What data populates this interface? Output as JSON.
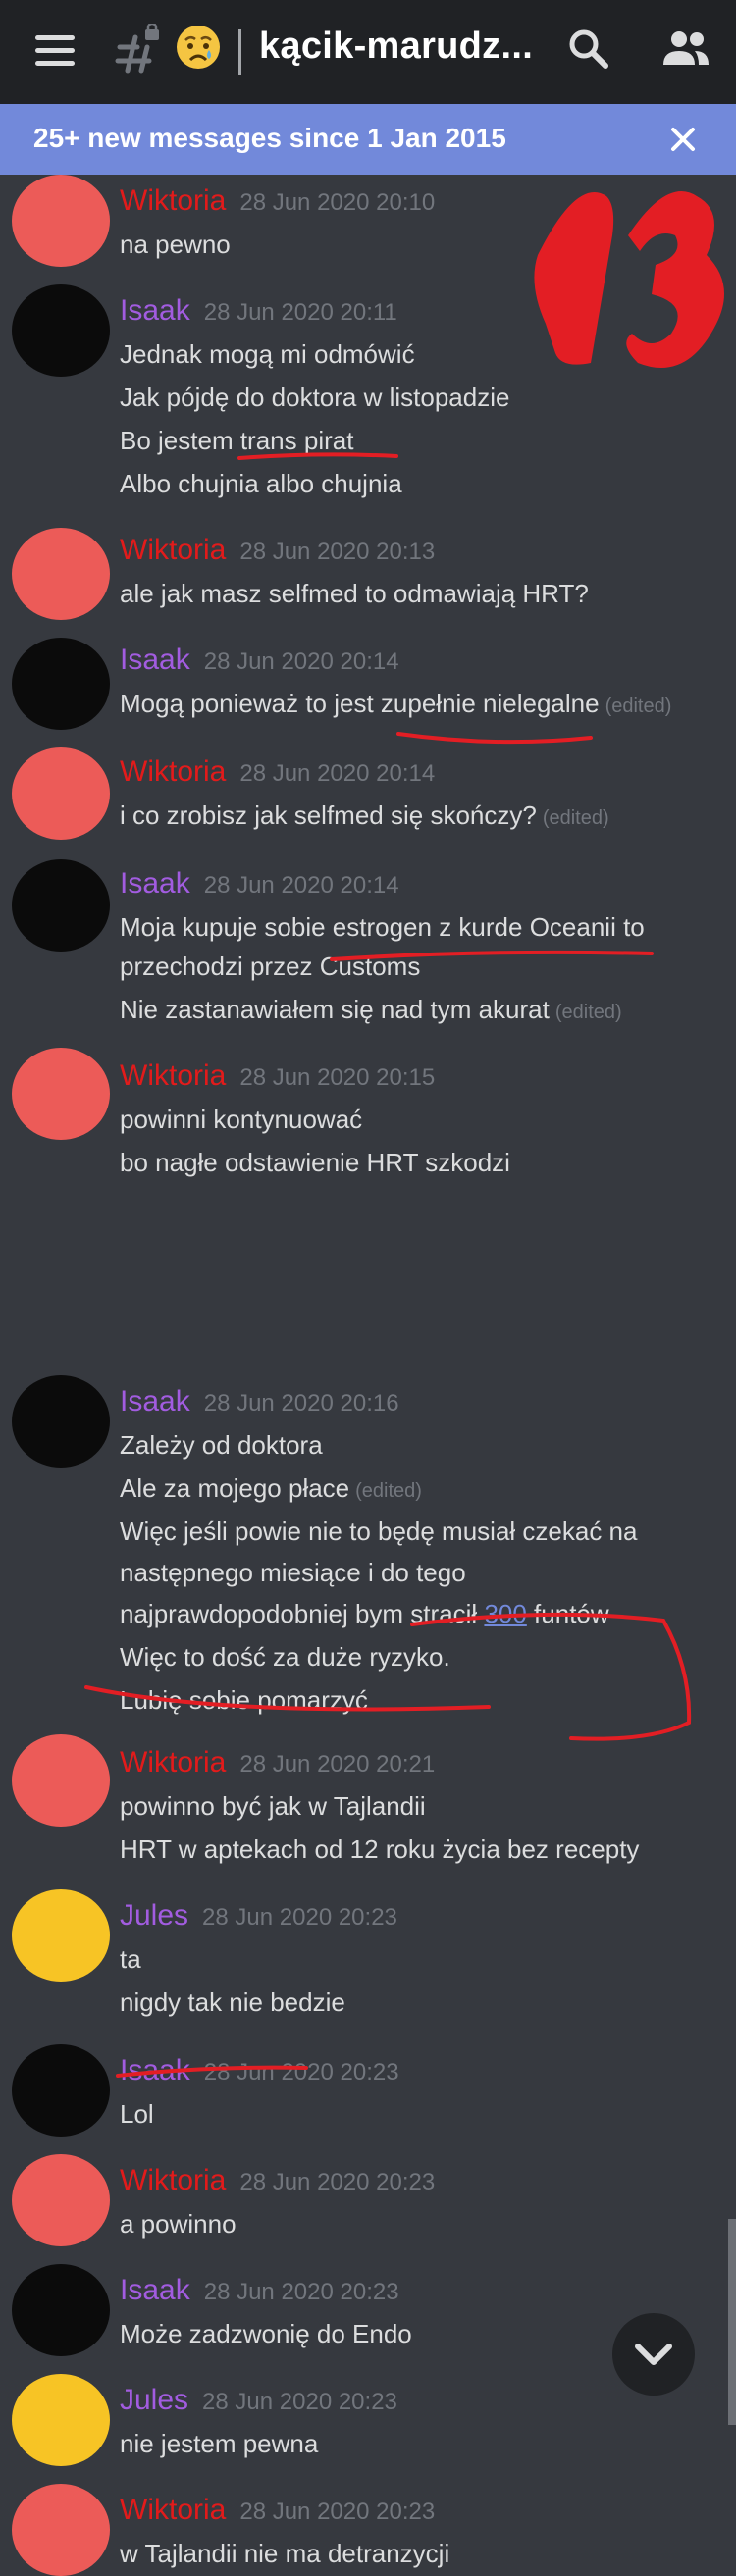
{
  "appbar": {
    "channel_name": "kącik-marudz...",
    "emoji": "😢"
  },
  "banner": {
    "text": "25+ new messages since 1 Jan 2015"
  },
  "annotation": {
    "number": "13"
  },
  "colors": {
    "wiktoria": "#e21b1b",
    "isaak": "#a25ce0",
    "jules": "#a25ce0",
    "accent": "#7289da",
    "marker": "#e31e24"
  },
  "messages": [
    {
      "author": "Wiktoria",
      "time": "28 Jun 2020 20:10",
      "lines": [
        "na pewno"
      ]
    },
    {
      "author": "Isaak",
      "time": "28 Jun 2020 20:11",
      "lines": [
        "Jednak mogą mi odmówić",
        "Jak pójdę do doktora w listopadzie",
        "Bo jestem trans pirat",
        "Albo chujnia albo chujnia"
      ]
    },
    {
      "author": "Wiktoria",
      "time": "28 Jun 2020 20:13",
      "lines": [
        "ale jak masz selfmed to odmawiają HRT?"
      ]
    },
    {
      "author": "Isaak",
      "time": "28 Jun 2020 20:14",
      "lines": [
        "Mogą ponieważ to jest  zupełnie nielegalne"
      ],
      "edited": "(edited)"
    },
    {
      "author": "Wiktoria",
      "time": "28 Jun 2020 20:14",
      "lines": [
        "i co zrobisz jak selfmed się skończy?"
      ],
      "edited": "(edited)"
    },
    {
      "author": "Isaak",
      "time": "28 Jun 2020 20:14",
      "lines": [
        "Moja kupuje sobie estrogen z kurde Oceanii to",
        "przechodzi przez Customs",
        "Nie zastanawiałem się nad tym akurat"
      ],
      "edited_line": "(edited)"
    },
    {
      "author": "Wiktoria",
      "time": "28 Jun 2020 20:15",
      "lines": [
        "powinni kontynuować",
        "bo nagłe odstawienie HRT szkodzi"
      ]
    },
    {
      "author": "Isaak",
      "time": "28 Jun 2020 20:16",
      "lines": [
        "Zależy od doktora",
        "Ale za mojego płace",
        "Więc jeśli powie nie to będę musiał czekać na",
        "następnego miesiące i do tego",
        "najprawdopodobniej bym stracił",
        "Więc to dość za duże ryzyko.",
        "Lubię sobie pomarzyć"
      ],
      "edited_line": "(edited)",
      "link_value": "300",
      "after_link": " funtów"
    },
    {
      "author": "Wiktoria",
      "time": "28 Jun 2020 20:21",
      "lines": [
        "powinno być jak w Tajlandii",
        "HRT w aptekach od 12 roku życia bez recepty"
      ]
    },
    {
      "author": "Jules",
      "time": "28 Jun 2020 20:23",
      "lines": [
        "ta",
        "nigdy tak nie bedzie"
      ]
    },
    {
      "author": "Isaak",
      "time": "28 Jun 2020 20:23",
      "lines": [
        "Lol"
      ]
    },
    {
      "author": "Wiktoria",
      "time": "28 Jun 2020 20:23",
      "lines": [
        "a powinno"
      ]
    },
    {
      "author": "Isaak",
      "time": "28 Jun 2020 20:23",
      "lines": [
        "Może zadzwonię do Endo"
      ]
    },
    {
      "author": "Jules",
      "time": "28 Jun 2020 20:23",
      "lines": [
        "nie jestem pewna"
      ]
    },
    {
      "author": "Wiktoria",
      "time": "28 Jun 2020 20:23",
      "lines": [
        "w Tajlandii nie ma detranzycji"
      ]
    }
  ]
}
